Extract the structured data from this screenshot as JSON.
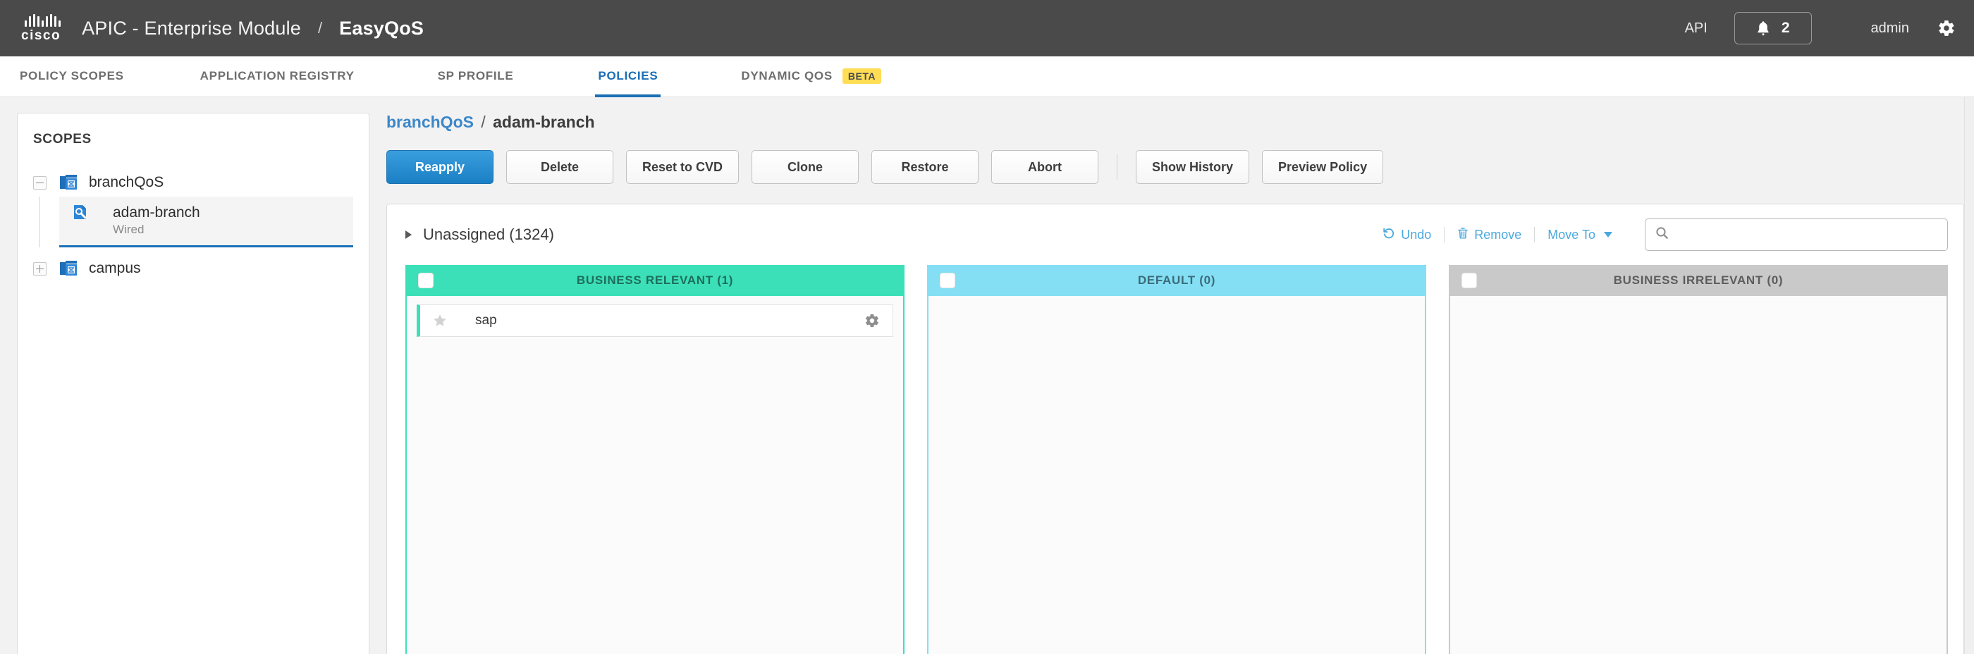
{
  "header": {
    "logo_text": "cisco",
    "title": "APIC - Enterprise Module",
    "separator": "/",
    "subtitle": "EasyQoS",
    "api_label": "API",
    "notification_count": "2",
    "user": "admin",
    "bar_color": "#4a4a4a"
  },
  "tabs": [
    {
      "label": "POLICY SCOPES",
      "active": false
    },
    {
      "label": "APPLICATION REGISTRY",
      "active": false
    },
    {
      "label": "SP PROFILE",
      "active": false
    },
    {
      "label": "POLICIES",
      "active": true
    },
    {
      "label": "DYNAMIC QOS",
      "active": false,
      "badge": "BETA"
    }
  ],
  "accent_color": "#1a6fb5",
  "sidebar": {
    "title": "SCOPES",
    "tree": [
      {
        "label": "branchQoS",
        "expanded": true,
        "children": [
          {
            "label": "adam-branch",
            "sublabel": "Wired",
            "selected": true
          }
        ]
      },
      {
        "label": "campus",
        "expanded": false,
        "children": []
      }
    ]
  },
  "main": {
    "breadcrumb": {
      "parent": "branchQoS",
      "separator": "/",
      "current": "adam-branch"
    },
    "actions": [
      {
        "label": "Reapply",
        "primary": true
      },
      {
        "label": "Delete",
        "primary": false
      },
      {
        "label": "Reset to CVD",
        "primary": false
      },
      {
        "label": "Clone",
        "primary": false
      },
      {
        "label": "Restore",
        "primary": false
      },
      {
        "label": "Abort",
        "primary": false
      }
    ],
    "actions_secondary": [
      {
        "label": "Show History"
      },
      {
        "label": "Preview Policy"
      }
    ],
    "group": {
      "label": "Unassigned (1324)",
      "expanded": false,
      "tools": [
        {
          "label": "Undo",
          "icon": "undo-icon"
        },
        {
          "label": "Remove",
          "icon": "trash-icon"
        },
        {
          "label": "Move To",
          "icon": "chevron-down-icon"
        }
      ],
      "search": {
        "value": "",
        "placeholder": ""
      }
    },
    "columns": [
      {
        "title": "BUSINESS RELEVANT (1)",
        "color": "#3ce0b8",
        "checked": false,
        "apps": [
          {
            "name": "sap",
            "favorite": false
          }
        ]
      },
      {
        "title": "DEFAULT (0)",
        "color": "#84dff5",
        "checked": false,
        "apps": []
      },
      {
        "title": "BUSINESS IRRELEVANT (0)",
        "color": "#c9c9c9",
        "checked": false,
        "apps": []
      }
    ]
  }
}
